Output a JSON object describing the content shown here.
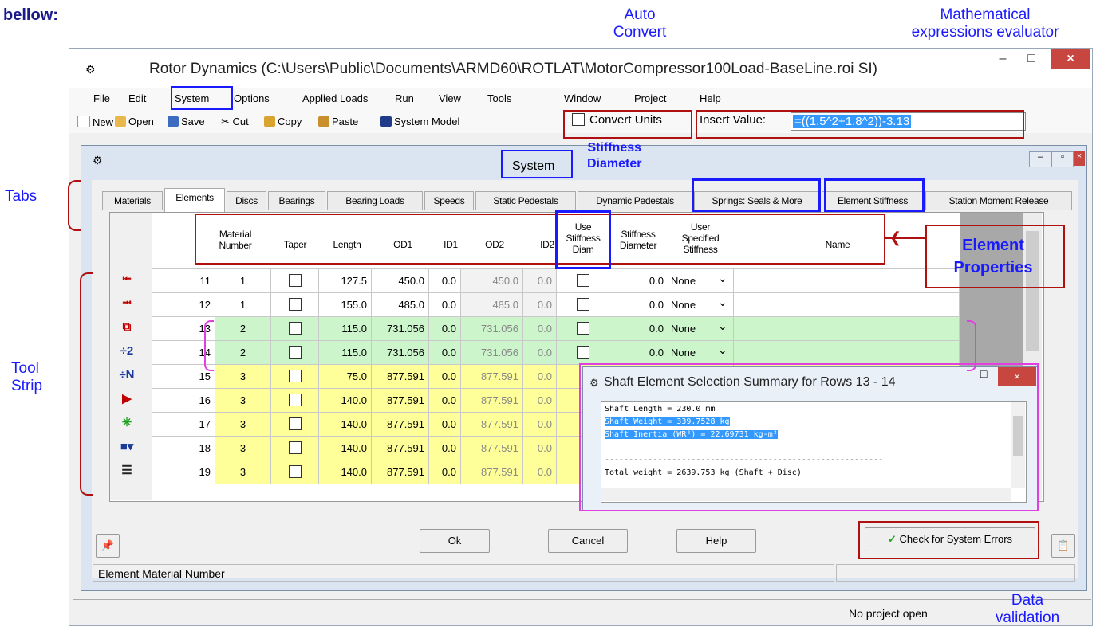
{
  "annotations": {
    "top_left": "bellow:",
    "auto_convert": "Auto\nConvert",
    "math_eval": "Mathematical\nexpressions evaluator",
    "tabs": "Tabs",
    "tool_strip": "Tool\nStrip",
    "stiffness_diameter": "Stiffness\nDiameter",
    "element_properties": "Element\nProperties",
    "data_validation": "Data\nvalidation"
  },
  "window": {
    "title": "Rotor Dynamics (C:\\Users\\Public\\Documents\\ARMD60\\ROTLAT\\MotorCompressor100Load-BaseLine.roi SI)",
    "minimize": "–",
    "maximize": "□",
    "close": "×"
  },
  "menu": [
    "File",
    "Edit",
    "System",
    "Options",
    "Applied Loads",
    "Run",
    "View",
    "Tools",
    "Window",
    "Project",
    "Help"
  ],
  "toolbar": {
    "new": "New",
    "open": "Open",
    "save": "Save",
    "cut": "Cut",
    "copy": "Copy",
    "paste": "Paste",
    "system_model": "System Model",
    "convert_units": "Convert Units",
    "insert_value_label": "Insert Value:",
    "insert_value": "=((1.5^2+1.8^2))-3.13"
  },
  "system_window": {
    "title": "System",
    "tabs": [
      "Materials",
      "Elements",
      "Discs",
      "Bearings",
      "Bearing Loads",
      "Speeds",
      "Static Pedestals",
      "Dynamic Pedestals",
      "Springs: Seals & More",
      "Element Stiffness",
      "Station Moment Release"
    ],
    "columns": [
      "Material\nNumber",
      "Taper",
      "Length",
      "OD1",
      "ID1",
      "OD2",
      "ID2",
      "Use\nStiffness\nDiam",
      "Stiffness\nDiameter",
      "User\nSpecified\nStiffness",
      "Name"
    ],
    "rows": [
      {
        "n": "11",
        "mat": "1",
        "len": "127.5",
        "od1": "450.0",
        "id1": "0.0",
        "od2": "450.0",
        "id2": "0.0",
        "sd": "0.0",
        "spec": "None",
        "color": "white"
      },
      {
        "n": "12",
        "mat": "1",
        "len": "155.0",
        "od1": "485.0",
        "id1": "0.0",
        "od2": "485.0",
        "id2": "0.0",
        "sd": "0.0",
        "spec": "None",
        "color": "white"
      },
      {
        "n": "13",
        "mat": "2",
        "len": "115.0",
        "od1": "731.056",
        "id1": "0.0",
        "od2": "731.056",
        "id2": "0.0",
        "sd": "0.0",
        "spec": "None",
        "color": "green"
      },
      {
        "n": "14",
        "mat": "2",
        "len": "115.0",
        "od1": "731.056",
        "id1": "0.0",
        "od2": "731.056",
        "id2": "0.0",
        "sd": "0.0",
        "spec": "None",
        "color": "green"
      },
      {
        "n": "15",
        "mat": "3",
        "len": "75.0",
        "od1": "877.591",
        "id1": "0.0",
        "od2": "877.591",
        "id2": "0.0",
        "sd": "",
        "spec": "",
        "color": "yellow"
      },
      {
        "n": "16",
        "mat": "3",
        "len": "140.0",
        "od1": "877.591",
        "id1": "0.0",
        "od2": "877.591",
        "id2": "0.0",
        "sd": "",
        "spec": "",
        "color": "yellow"
      },
      {
        "n": "17",
        "mat": "3",
        "len": "140.0",
        "od1": "877.591",
        "id1": "0.0",
        "od2": "877.591",
        "id2": "0.0",
        "sd": "",
        "spec": "",
        "color": "yellow"
      },
      {
        "n": "18",
        "mat": "3",
        "len": "140.0",
        "od1": "877.591",
        "id1": "0.0",
        "od2": "877.591",
        "id2": "0.0",
        "sd": "",
        "spec": "",
        "color": "yellow"
      },
      {
        "n": "19",
        "mat": "3",
        "len": "140.0",
        "od1": "877.591",
        "id1": "0.0",
        "od2": "877.591",
        "id2": "0.0",
        "sd": "",
        "spec": "",
        "color": "yellow"
      }
    ],
    "tool_icons": [
      "⭰",
      "⭲",
      "⧉",
      "÷2",
      "÷N",
      "▶",
      "✳",
      "■▾",
      "☰"
    ],
    "buttons": {
      "ok": "Ok",
      "cancel": "Cancel",
      "help": "Help",
      "check": "Check for System Errors"
    },
    "status": "Element Material Number"
  },
  "popup": {
    "title": "Shaft Element Selection Summary for Rows 13 - 14",
    "lines": [
      "Shaft Length = 230.0 mm",
      "Shaft Weight = 339.7528 kg",
      "Shaft Inertia (WR²) = 22.69731 kg-m²",
      "",
      "----------------------------------------------------------",
      "Total weight = 2639.753 kg (Shaft + Disc)"
    ]
  },
  "main_status": "No project open",
  "colors": {
    "green": "#ccf5cc",
    "yellow": "#ffff99",
    "white": "#ffffff",
    "accent": "#1a1aff",
    "annotation_red": "#b01010"
  }
}
